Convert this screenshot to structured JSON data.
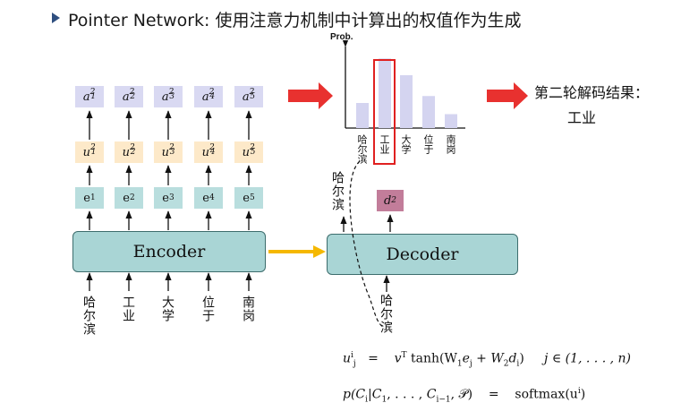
{
  "title": "Pointer Network: 使用注意力机制中计算出的权值作为生成",
  "encoder_label": "Encoder",
  "decoder_label": "Decoder",
  "encoder_inputs": [
    "哈尔滨",
    "工业",
    "大学",
    "位于",
    "南岗"
  ],
  "attention_labels": [
    "a",
    "a",
    "a",
    "a",
    "a"
  ],
  "score_labels": [
    "u",
    "u",
    "u",
    "u",
    "u"
  ],
  "embedding_labels": [
    "e",
    "e",
    "e",
    "e",
    "e"
  ],
  "subscripts": [
    "1",
    "2",
    "3",
    "4",
    "5"
  ],
  "superscript": "2",
  "decoder_input": "哈尔滨",
  "decoder_prev_output": "哈尔滨",
  "decoder_state": "d",
  "decoder_state_sub": "2",
  "result_label": "第二轮解码结果：",
  "result_word": "工业",
  "formula_1": {
    "lhs": "u",
    "rhs": "v",
    "tanh": "tanh(W",
    "rest": "j ∈ (1, . . . , n)"
  },
  "formula_2": {
    "lhs": "p(C",
    "rhs": "softmax(u"
  },
  "colors": {
    "attention_box": "#d9d9f2",
    "score_box": "#fde9c9",
    "embedding_box": "#b9dede",
    "encoder_decoder": "#a9d5d5",
    "decoder_state": "#c27d9a",
    "red_arrow": "#e8312f",
    "yellow_arrow": "#f5b800",
    "highlight": "#e02020",
    "bar": "#d4d4f0"
  },
  "chart_data": {
    "type": "bar",
    "ylabel": "Prob.",
    "categories": [
      "哈尔滨",
      "工业",
      "大学",
      "位于",
      "南岗"
    ],
    "values": [
      0.18,
      0.5,
      0.38,
      0.23,
      0.1
    ],
    "highlighted_category": "工业"
  }
}
